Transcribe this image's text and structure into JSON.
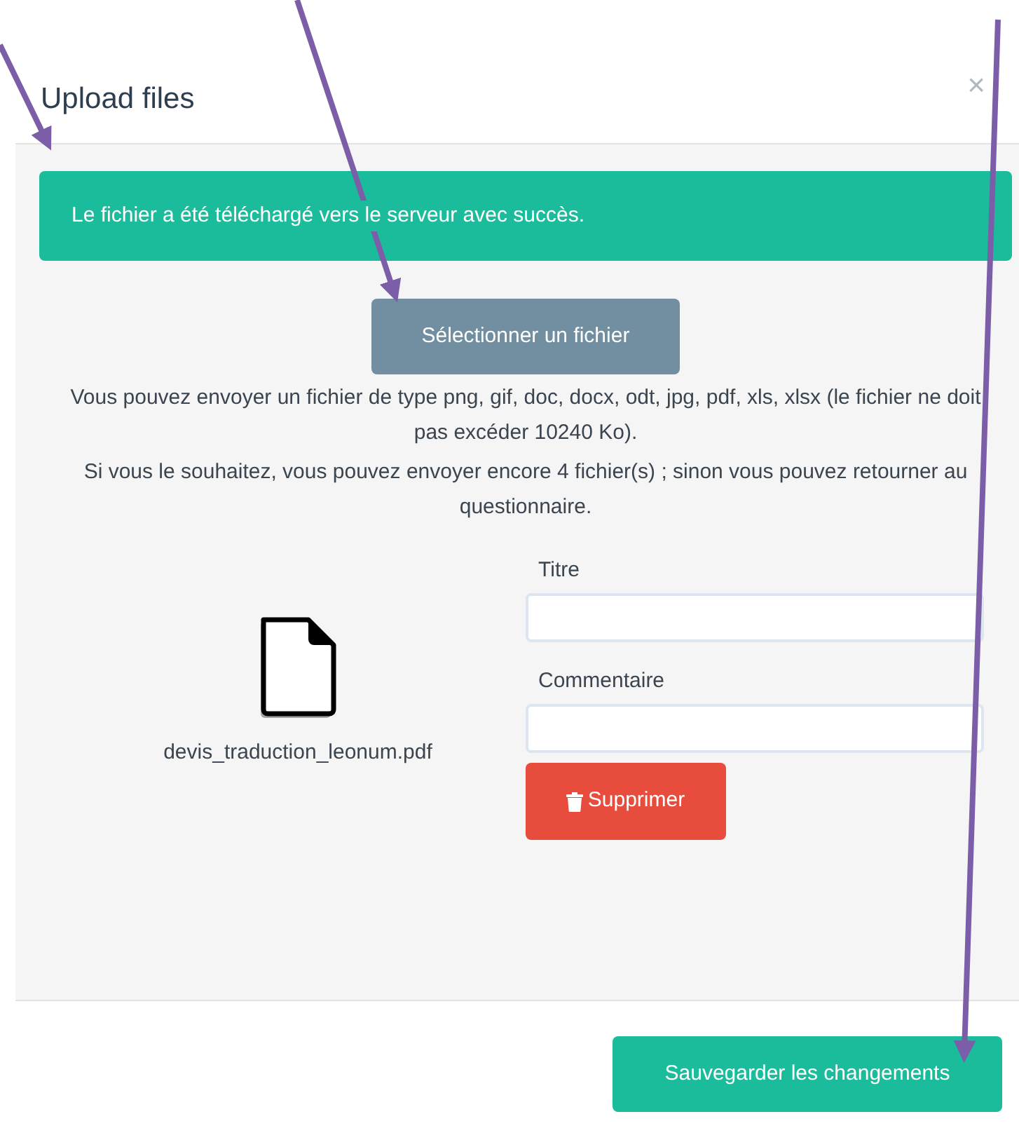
{
  "dialog": {
    "title": "Upload files",
    "close": "×"
  },
  "alert": {
    "text": "Le fichier a été téléchargé vers le serveur avec succès."
  },
  "select_button": "Sélectionner un fichier",
  "info": [
    "Vous pouvez envoyer un fichier de type png, gif, doc, docx, odt, jpg, pdf, xls, xlsx (le fichier ne doit pas excéder 10240 Ko).",
    "Si vous le souhaitez, vous pouvez envoyer encore 4 fichier(s) ; sinon vous pouvez retourner au questionnaire."
  ],
  "file": {
    "name": "devis_traduction_leonum.pdf",
    "fields": [
      {
        "label": "Titre"
      },
      {
        "label": "Commentaire"
      }
    ],
    "delete_button": "Supprimer"
  },
  "footer": {
    "save_button": "Sauvegarder les changements"
  }
}
